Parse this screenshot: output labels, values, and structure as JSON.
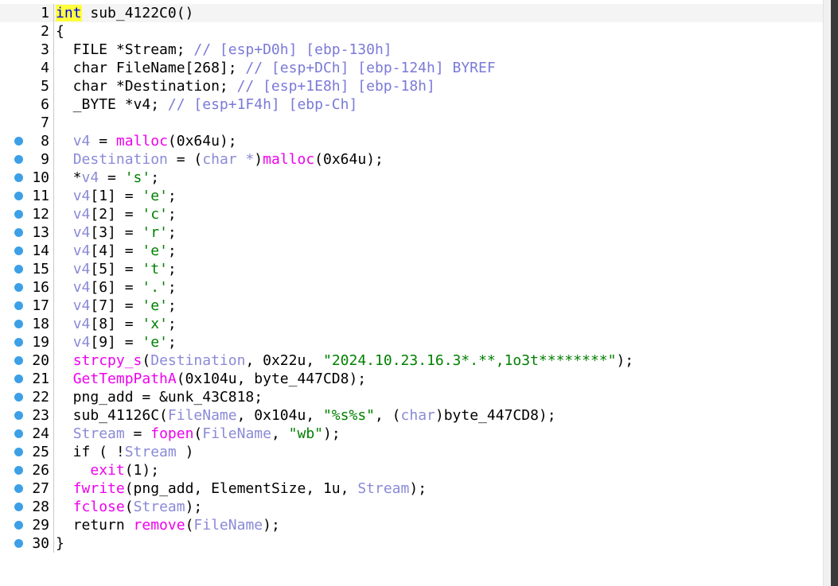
{
  "editor": {
    "accent_dot_color": "#3da0e6",
    "lines": [
      {
        "n": "1",
        "dot": false,
        "hl": true,
        "tokens": [
          {
            "t": "int",
            "c": "kw-hl"
          },
          {
            "t": " sub_4122C0()",
            "c": "pl"
          }
        ]
      },
      {
        "n": "2",
        "dot": false,
        "hl": false,
        "tokens": [
          {
            "t": "{",
            "c": "pl"
          }
        ]
      },
      {
        "n": "3",
        "dot": false,
        "hl": false,
        "tokens": [
          {
            "t": "  FILE *Stream; ",
            "c": "pl"
          },
          {
            "t": "// [esp+D0h] [ebp-130h]",
            "c": "cm"
          }
        ]
      },
      {
        "n": "4",
        "dot": false,
        "hl": false,
        "tokens": [
          {
            "t": "  char FileName[268]; ",
            "c": "pl"
          },
          {
            "t": "// [esp+DCh] [ebp-124h] BYREF",
            "c": "cm"
          }
        ]
      },
      {
        "n": "5",
        "dot": false,
        "hl": false,
        "tokens": [
          {
            "t": "  char *Destination; ",
            "c": "pl"
          },
          {
            "t": "// [esp+1E8h] [ebp-18h]",
            "c": "cm"
          }
        ]
      },
      {
        "n": "6",
        "dot": false,
        "hl": false,
        "tokens": [
          {
            "t": "  _BYTE *v4; ",
            "c": "pl"
          },
          {
            "t": "// [esp+1F4h] [ebp-Ch]",
            "c": "cm"
          }
        ]
      },
      {
        "n": "7",
        "dot": false,
        "hl": false,
        "tokens": [
          {
            "t": "",
            "c": "pl"
          }
        ]
      },
      {
        "n": "8",
        "dot": true,
        "hl": false,
        "tokens": [
          {
            "t": "  ",
            "c": "pl"
          },
          {
            "t": "v4",
            "c": "var"
          },
          {
            "t": " = ",
            "c": "pl"
          },
          {
            "t": "malloc",
            "c": "fn"
          },
          {
            "t": "(0x64u);",
            "c": "pl"
          }
        ]
      },
      {
        "n": "9",
        "dot": true,
        "hl": false,
        "tokens": [
          {
            "t": "  ",
            "c": "pl"
          },
          {
            "t": "Destination",
            "c": "var"
          },
          {
            "t": " = (",
            "c": "pl"
          },
          {
            "t": "char *",
            "c": "type-muted"
          },
          {
            "t": ")",
            "c": "pl"
          },
          {
            "t": "malloc",
            "c": "fn"
          },
          {
            "t": "(0x64u);",
            "c": "pl"
          }
        ]
      },
      {
        "n": "10",
        "dot": true,
        "hl": false,
        "tokens": [
          {
            "t": "  *",
            "c": "pl"
          },
          {
            "t": "v4",
            "c": "var"
          },
          {
            "t": " = ",
            "c": "pl"
          },
          {
            "t": "'s'",
            "c": "str"
          },
          {
            "t": ";",
            "c": "pl"
          }
        ]
      },
      {
        "n": "11",
        "dot": true,
        "hl": false,
        "tokens": [
          {
            "t": "  ",
            "c": "pl"
          },
          {
            "t": "v4",
            "c": "var"
          },
          {
            "t": "[1] = ",
            "c": "pl"
          },
          {
            "t": "'e'",
            "c": "str"
          },
          {
            "t": ";",
            "c": "pl"
          }
        ]
      },
      {
        "n": "12",
        "dot": true,
        "hl": false,
        "tokens": [
          {
            "t": "  ",
            "c": "pl"
          },
          {
            "t": "v4",
            "c": "var"
          },
          {
            "t": "[2] = ",
            "c": "pl"
          },
          {
            "t": "'c'",
            "c": "str"
          },
          {
            "t": ";",
            "c": "pl"
          }
        ]
      },
      {
        "n": "13",
        "dot": true,
        "hl": false,
        "tokens": [
          {
            "t": "  ",
            "c": "pl"
          },
          {
            "t": "v4",
            "c": "var"
          },
          {
            "t": "[3] = ",
            "c": "pl"
          },
          {
            "t": "'r'",
            "c": "str"
          },
          {
            "t": ";",
            "c": "pl"
          }
        ]
      },
      {
        "n": "14",
        "dot": true,
        "hl": false,
        "tokens": [
          {
            "t": "  ",
            "c": "pl"
          },
          {
            "t": "v4",
            "c": "var"
          },
          {
            "t": "[4] = ",
            "c": "pl"
          },
          {
            "t": "'e'",
            "c": "str"
          },
          {
            "t": ";",
            "c": "pl"
          }
        ]
      },
      {
        "n": "15",
        "dot": true,
        "hl": false,
        "tokens": [
          {
            "t": "  ",
            "c": "pl"
          },
          {
            "t": "v4",
            "c": "var"
          },
          {
            "t": "[5] = ",
            "c": "pl"
          },
          {
            "t": "'t'",
            "c": "str"
          },
          {
            "t": ";",
            "c": "pl"
          }
        ]
      },
      {
        "n": "16",
        "dot": true,
        "hl": false,
        "tokens": [
          {
            "t": "  ",
            "c": "pl"
          },
          {
            "t": "v4",
            "c": "var"
          },
          {
            "t": "[6] = ",
            "c": "pl"
          },
          {
            "t": "'.'",
            "c": "str"
          },
          {
            "t": ";",
            "c": "pl"
          }
        ]
      },
      {
        "n": "17",
        "dot": true,
        "hl": false,
        "tokens": [
          {
            "t": "  ",
            "c": "pl"
          },
          {
            "t": "v4",
            "c": "var"
          },
          {
            "t": "[7] = ",
            "c": "pl"
          },
          {
            "t": "'e'",
            "c": "str"
          },
          {
            "t": ";",
            "c": "pl"
          }
        ]
      },
      {
        "n": "18",
        "dot": true,
        "hl": false,
        "tokens": [
          {
            "t": "  ",
            "c": "pl"
          },
          {
            "t": "v4",
            "c": "var"
          },
          {
            "t": "[8] = ",
            "c": "pl"
          },
          {
            "t": "'x'",
            "c": "str"
          },
          {
            "t": ";",
            "c": "pl"
          }
        ]
      },
      {
        "n": "19",
        "dot": true,
        "hl": false,
        "tokens": [
          {
            "t": "  ",
            "c": "pl"
          },
          {
            "t": "v4",
            "c": "var"
          },
          {
            "t": "[9] = ",
            "c": "pl"
          },
          {
            "t": "'e'",
            "c": "str"
          },
          {
            "t": ";",
            "c": "pl"
          }
        ]
      },
      {
        "n": "20",
        "dot": true,
        "hl": false,
        "tokens": [
          {
            "t": "  ",
            "c": "pl"
          },
          {
            "t": "strcpy_s",
            "c": "fn"
          },
          {
            "t": "(",
            "c": "pl"
          },
          {
            "t": "Destination",
            "c": "var"
          },
          {
            "t": ", 0x22u, ",
            "c": "pl"
          },
          {
            "t": "\"2024.10.23.16.3*.**,1o3t********\"",
            "c": "str"
          },
          {
            "t": ");",
            "c": "pl"
          }
        ]
      },
      {
        "n": "21",
        "dot": true,
        "hl": false,
        "tokens": [
          {
            "t": "  ",
            "c": "pl"
          },
          {
            "t": "GetTempPathA",
            "c": "fn"
          },
          {
            "t": "(0x104u, byte_447CD8);",
            "c": "pl"
          }
        ]
      },
      {
        "n": "22",
        "dot": true,
        "hl": false,
        "tokens": [
          {
            "t": "  png_add = &unk_43C818;",
            "c": "pl"
          }
        ]
      },
      {
        "n": "23",
        "dot": true,
        "hl": false,
        "tokens": [
          {
            "t": "  sub_41126C(",
            "c": "pl"
          },
          {
            "t": "FileName",
            "c": "var"
          },
          {
            "t": ", 0x104u, ",
            "c": "pl"
          },
          {
            "t": "\"%s%s\"",
            "c": "str"
          },
          {
            "t": ", (",
            "c": "pl"
          },
          {
            "t": "char",
            "c": "type-muted"
          },
          {
            "t": ")byte_447CD8);",
            "c": "pl"
          }
        ]
      },
      {
        "n": "24",
        "dot": true,
        "hl": false,
        "tokens": [
          {
            "t": "  ",
            "c": "pl"
          },
          {
            "t": "Stream",
            "c": "var"
          },
          {
            "t": " = ",
            "c": "pl"
          },
          {
            "t": "fopen",
            "c": "fn"
          },
          {
            "t": "(",
            "c": "pl"
          },
          {
            "t": "FileName",
            "c": "var"
          },
          {
            "t": ", ",
            "c": "pl"
          },
          {
            "t": "\"wb\"",
            "c": "str"
          },
          {
            "t": ");",
            "c": "pl"
          }
        ]
      },
      {
        "n": "25",
        "dot": true,
        "hl": false,
        "tokens": [
          {
            "t": "  if ( !",
            "c": "pl"
          },
          {
            "t": "Stream",
            "c": "var"
          },
          {
            "t": " )",
            "c": "pl"
          }
        ]
      },
      {
        "n": "26",
        "dot": true,
        "hl": false,
        "tokens": [
          {
            "t": "    ",
            "c": "pl"
          },
          {
            "t": "exit",
            "c": "fn"
          },
          {
            "t": "(1);",
            "c": "pl"
          }
        ]
      },
      {
        "n": "27",
        "dot": true,
        "hl": false,
        "tokens": [
          {
            "t": "  ",
            "c": "pl"
          },
          {
            "t": "fwrite",
            "c": "fn"
          },
          {
            "t": "(png_add, ElementSize, 1u, ",
            "c": "pl"
          },
          {
            "t": "Stream",
            "c": "var"
          },
          {
            "t": ");",
            "c": "pl"
          }
        ]
      },
      {
        "n": "28",
        "dot": true,
        "hl": false,
        "tokens": [
          {
            "t": "  ",
            "c": "pl"
          },
          {
            "t": "fclose",
            "c": "fn"
          },
          {
            "t": "(",
            "c": "pl"
          },
          {
            "t": "Stream",
            "c": "var"
          },
          {
            "t": ");",
            "c": "pl"
          }
        ]
      },
      {
        "n": "29",
        "dot": true,
        "hl": false,
        "tokens": [
          {
            "t": "  return ",
            "c": "pl"
          },
          {
            "t": "remove",
            "c": "fn"
          },
          {
            "t": "(",
            "c": "pl"
          },
          {
            "t": "FileName",
            "c": "var"
          },
          {
            "t": ");",
            "c": "pl"
          }
        ]
      },
      {
        "n": "30",
        "dot": true,
        "hl": false,
        "tokens": [
          {
            "t": "}",
            "c": "pl"
          }
        ]
      }
    ]
  }
}
